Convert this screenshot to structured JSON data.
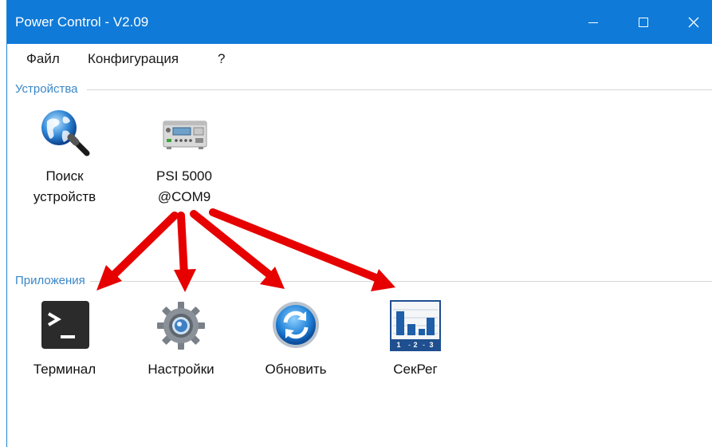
{
  "window": {
    "title": "Power Control - V2.09"
  },
  "menu": {
    "items": [
      "Файл",
      "Конфигурация",
      "?"
    ]
  },
  "devices": {
    "group_label": "Устройства",
    "tiles": [
      {
        "label": "Поиск\nустройств",
        "icon": "globe-search-icon"
      },
      {
        "label": "PSI 5000\n@COM9",
        "icon": "power-supply-icon"
      }
    ]
  },
  "apps": {
    "group_label": "Приложения",
    "tiles": [
      {
        "label": "Терминал",
        "icon": "terminal-icon"
      },
      {
        "label": "Настройки",
        "icon": "gear-icon"
      },
      {
        "label": "Обновить",
        "icon": "refresh-icon"
      },
      {
        "label": "СекРег",
        "icon": "sequence-chart-icon"
      }
    ]
  },
  "colors": {
    "titlebar": "#0f7ad8",
    "group_label": "#3a87c7",
    "annotation_arrows": "#e60000"
  }
}
